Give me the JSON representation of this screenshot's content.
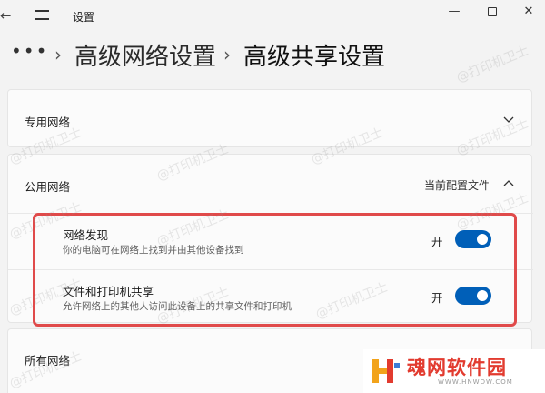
{
  "window": {
    "title": "设置",
    "back_glyph": "←",
    "min_glyph": "—",
    "close_glyph": "✕"
  },
  "breadcrumb": {
    "more": "•••",
    "separator": "›",
    "parent": "高级网络设置",
    "current": "高级共享设置"
  },
  "sections": {
    "private": {
      "label": "专用网络",
      "expanded": false
    },
    "public": {
      "label": "公用网络",
      "profile_label": "当前配置文件",
      "expanded": true,
      "rows": [
        {
          "title": "网络发现",
          "desc": "你的电脑可在网络上找到并由其他设备找到",
          "state": "开",
          "on": true
        },
        {
          "title": "文件和打印机共享",
          "desc": "允许网络上的其他人访问此设备上的共享文件和打印机",
          "state": "开",
          "on": true
        }
      ]
    },
    "all": {
      "label": "所有网络"
    }
  },
  "watermark": "@打印机卫士",
  "logo": {
    "text": "魂网软件园",
    "url": "WWW.HNWDW.COM"
  },
  "colors": {
    "toggle_on": "#005fb8",
    "highlight_border": "#e04a4a",
    "logo_red": "#e23b2f"
  }
}
